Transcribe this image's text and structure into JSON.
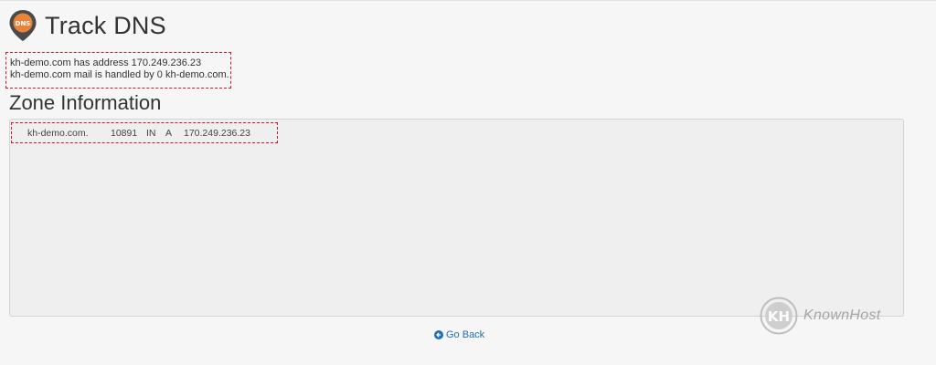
{
  "header": {
    "title": "Track DNS",
    "icon": "dns-pin-icon",
    "icon_label": "DNS",
    "icon_color": "#e8833a"
  },
  "lookup": {
    "lines": [
      "kh-demo.com has address 170.249.236.23",
      "kh-demo.com mail is handled by 0 kh-demo.com."
    ],
    "highlight_color": "#d0162e"
  },
  "zone": {
    "heading": "Zone Information",
    "record": {
      "name": "kh-demo.com.",
      "ttl": "10891",
      "class": "IN",
      "type": "A",
      "address": "170.249.236.23"
    }
  },
  "footer": {
    "go_back_label": "Go Back",
    "go_back_icon": "circle-arrow-left-icon",
    "link_color": "#1f6fb5"
  },
  "watermark": {
    "brand": "KnownHost",
    "mark": "KH",
    "logo_icon": "knownhost-logo-icon"
  }
}
